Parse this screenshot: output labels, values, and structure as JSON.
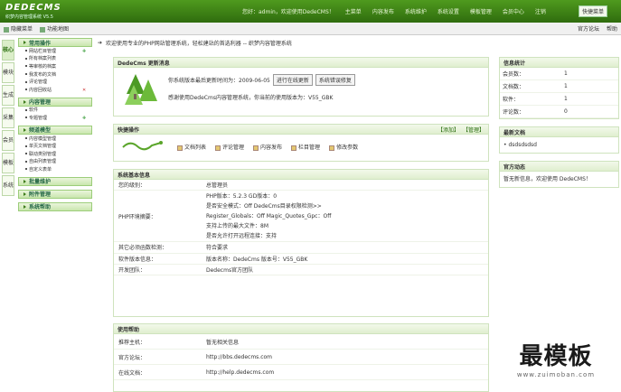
{
  "brand": {
    "logo": "DEDECMS",
    "sub": "织梦内容管理系统 V5.5"
  },
  "topnav": [
    "您好：admin，欢迎使用DedeCMS！",
    "主菜单",
    "内容发布",
    "系统维护",
    "系统设置",
    "模板管理",
    "会员中心",
    "注销"
  ],
  "quickmenu": "快捷菜单",
  "bar2": {
    "left1": "隐藏菜单",
    "left2": "功能地图",
    "right1": "官方论坛",
    "right2": "帮助"
  },
  "vtabs": [
    "核心",
    "模块",
    "生成",
    "采集",
    "会员",
    "模板",
    "系统"
  ],
  "sidebar": [
    {
      "title": "常用操作",
      "items": [
        "网站栏目管理",
        "所有档案列表",
        "等审核的档案",
        "我发布的文档",
        "评论管理",
        "内容回收站"
      ]
    },
    {
      "title": "内容管理",
      "items": [
        "软件",
        "专题管理"
      ]
    },
    {
      "title": "频道模型",
      "items": [
        "内容模型管理",
        "单页文档管理",
        "联动类别管理",
        "自由列表管理",
        "自定义表单"
      ]
    },
    {
      "title": "批量维护",
      "items": []
    },
    {
      "title": "附件管理",
      "items": []
    },
    {
      "title": "系统帮助",
      "items": []
    }
  ],
  "welcome": "欢迎使用专业的PHP网站管理系统，轻松建站的首选利器 -- 织梦内容管理系统",
  "version": {
    "title": "DedeCms 更新消息",
    "line1": "你系统版本最后更新时间为：2009-06-05",
    "btn1": "进行在线更新",
    "btn2": "系统错误修复",
    "line2": "感谢使用DedeCms内容管理系统，你当前的使用版本为：V55_GBK"
  },
  "quick": {
    "title": "快捷操作",
    "add": "【添加】",
    "manage": "【管理】",
    "links": [
      "文档列表",
      "评论管理",
      "内容发布",
      "栏目管理",
      "修改参数"
    ]
  },
  "sysinfo": {
    "title": "系统基本信息",
    "rows": [
      {
        "k": "您的级别：",
        "v": "总管理员"
      },
      {
        "k": "PHP环境摘要：",
        "subs": [
          "PHP版本：5.2.3    GD版本：0",
          "是否安全模式：Off    DedeCms目录权限检测>>",
          "Register_Globals：Off    Magic_Quotes_Gpc：Off",
          "支持上传的最大文件：8M",
          "是否允许打开远程连接：支持"
        ]
      },
      {
        "k": "其它必须函数检测：",
        "v": "符合要求"
      },
      {
        "k": "软件版本信息：",
        "v": "版本名称：DedeCms    版本号：V55_GBK"
      },
      {
        "k": "开发团队：",
        "v": "Dedecms官方团队"
      }
    ]
  },
  "help": {
    "title": "使用帮助",
    "rows": [
      {
        "k": "推荐主机：",
        "v": "暂无相关信息"
      },
      {
        "k": "官方论坛：",
        "v": "http://bbs.dedecms.com"
      },
      {
        "k": "在线文档：",
        "v": "http://help.dedecms.com"
      }
    ]
  },
  "stats": {
    "title": "信息统计",
    "rows": [
      {
        "k": "会员数：",
        "n": "1"
      },
      {
        "k": "文档数：",
        "n": "1"
      },
      {
        "k": "软件：",
        "n": "1"
      },
      {
        "k": "评论数：",
        "n": "0"
      }
    ]
  },
  "mydocs": {
    "title": "最新文档",
    "item": "• dsdsdsdsd"
  },
  "official": {
    "title": "官方动态",
    "text": "暂无新信息，欢迎使用 DedeCMS！"
  },
  "watermark": {
    "big": "最模板",
    "url": "www.zuimoban.com"
  }
}
